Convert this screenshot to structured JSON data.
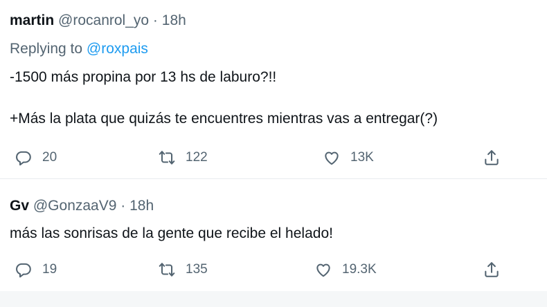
{
  "tweets": [
    {
      "name": "martin",
      "handle": "@rocanrol_yo",
      "separator": "·",
      "time": "18h",
      "replying_prefix": "Replying to",
      "replying_to": "@roxpais",
      "text_lines": [
        "-1500 más propina por 13 hs de laburo?!!",
        "+Más la plata que quizás te encuentres mientras vas a entregar(?)"
      ],
      "actions": {
        "replies": "20",
        "retweets": "122",
        "likes": "13K"
      }
    },
    {
      "name": "Gv",
      "handle": "@GonzaaV9",
      "separator": "·",
      "time": "18h",
      "text_lines": [
        "más las sonrisas de la gente que recibe el helado!"
      ],
      "actions": {
        "replies": "19",
        "retweets": "135",
        "likes": "19.3K"
      }
    }
  ],
  "icons": {
    "reply": "reply-icon",
    "retweet": "retweet-icon",
    "like": "heart-icon",
    "share": "share-icon"
  },
  "colors": {
    "text": "#0f1419",
    "secondary": "#536471",
    "link": "#1d9bf0",
    "divider": "#e8ecef"
  }
}
